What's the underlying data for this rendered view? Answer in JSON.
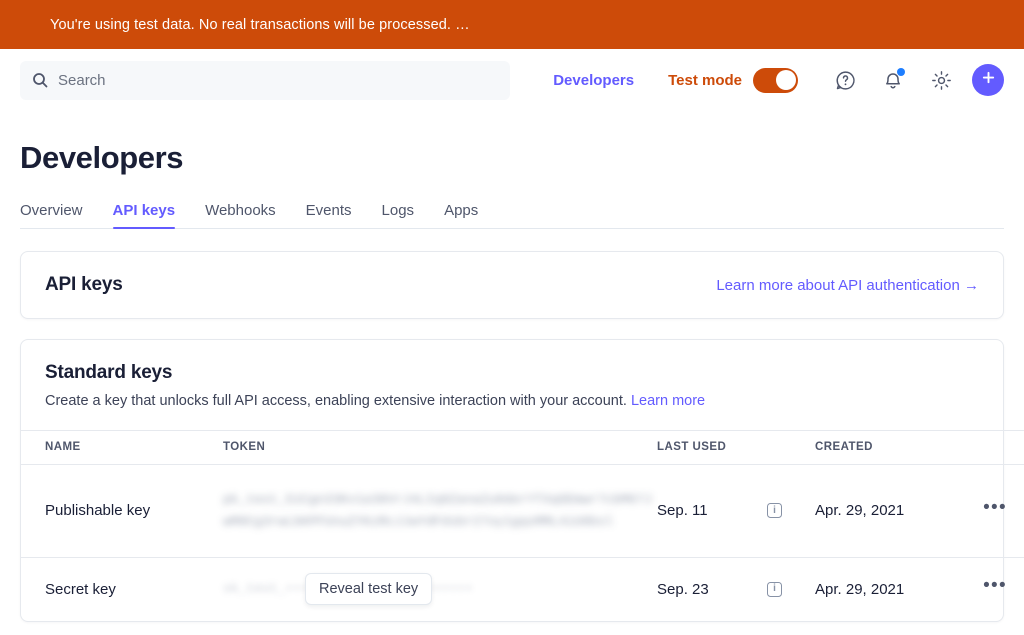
{
  "banner": {
    "message": "You're using test data. No real transactions will be processed. …",
    "bg_color": "#cd4b09"
  },
  "header": {
    "search": {
      "placeholder": "Search",
      "value": "",
      "icon": "search-icon"
    },
    "developers_label": "Developers",
    "test_mode_label": "Test mode",
    "test_mode_on": true,
    "icons": {
      "help": "help-circle-icon",
      "notifications": "bell-icon",
      "settings": "gear-icon",
      "create": "plus-icon"
    },
    "accent_purple": "#635bff",
    "accent_orange": "#cd4b09",
    "notification_dot_color": "#1e7eff"
  },
  "page": {
    "title": "Developers",
    "tabs": [
      {
        "label": "Overview",
        "active": false
      },
      {
        "label": "API keys",
        "active": true
      },
      {
        "label": "Webhooks",
        "active": false
      },
      {
        "label": "Events",
        "active": false
      },
      {
        "label": "Logs",
        "active": false
      },
      {
        "label": "Apps",
        "active": false
      }
    ]
  },
  "api_keys_card": {
    "title": "API keys",
    "learn_more_link": "Learn more about API authentication →"
  },
  "standard_keys_card": {
    "title": "Standard keys",
    "description": "Create a key that unlocks full API access, enabling extensive interaction with your account.",
    "description_link": "Learn more",
    "columns": [
      "NAME",
      "TOKEN",
      "LAST USED",
      "CREATED"
    ],
    "rows": [
      {
        "name": "Publishable key",
        "token_masked": "pk_test_51Cgn33Kv1a38VrJ4LIq8ZanaZu0derYTXqGEmwr7cbM67JwM8Cg3rwLbKPFUnuZYKzRcJJwYdFdsbr27oy1gqsMML4iU0bsl",
        "token_obscured": true,
        "last_used": "Sep. 11",
        "info_icon": "info-icon",
        "created": "Apr. 29, 2021",
        "menu_icon": "ellipsis-icon",
        "reveal_button": null
      },
      {
        "name": "Secret key",
        "token_masked": "sk_test_••••••••••••••••••••••••",
        "token_obscured": true,
        "last_used": "Sep. 23",
        "info_icon": "info-icon",
        "created": "Apr. 29, 2021",
        "menu_icon": "ellipsis-icon",
        "reveal_button": "Reveal test key"
      }
    ]
  }
}
